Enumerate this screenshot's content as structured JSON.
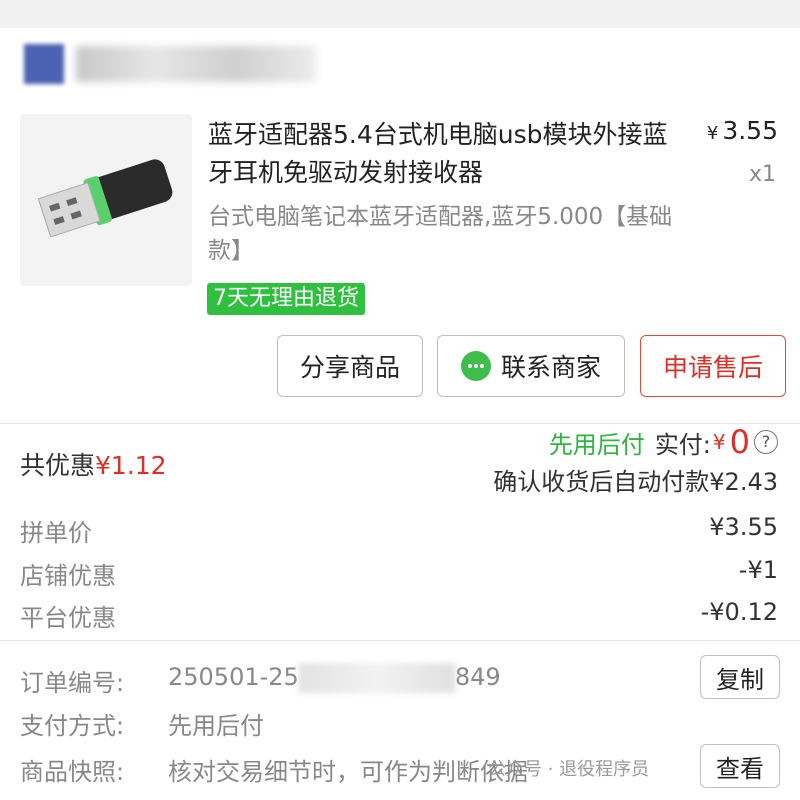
{
  "product": {
    "title": "蓝牙适配器5.4台式机电脑usb模块外接蓝牙耳机免驱动发射接收器",
    "price_symbol": "¥",
    "price": "3.55",
    "quantity": "x1",
    "spec": "台式电脑笔记本蓝牙适配器,蓝牙5.000【基础款】",
    "tag": "7天无理由退货"
  },
  "actions": {
    "share": "分享商品",
    "contact": "联系商家",
    "after_sale": "申请售后"
  },
  "summary": {
    "discount_label": "共优惠",
    "discount_amount": "¥1.12",
    "pay_later": "先用后付",
    "paid_label": "实付:",
    "paid_symbol": "¥",
    "paid_amount": "0",
    "auto_pay": "确认收货后自动付款¥2.43"
  },
  "breakdown": [
    {
      "label": "拼单价",
      "value": "¥3.55"
    },
    {
      "label": "店铺优惠",
      "value": "-¥1"
    },
    {
      "label": "平台优惠",
      "value": "-¥0.12"
    }
  ],
  "order": {
    "number_label": "订单编号:",
    "number_prefix": "250501-25",
    "number_suffix": "849",
    "copy_button": "复制",
    "pay_method_label": "支付方式:",
    "pay_method": "先用后付",
    "snapshot_label": "商品快照:",
    "snapshot_text": "核对交易细节时，可作为判断依据",
    "view_button": "查看"
  },
  "watermark": "公众号 · 退役程序员"
}
